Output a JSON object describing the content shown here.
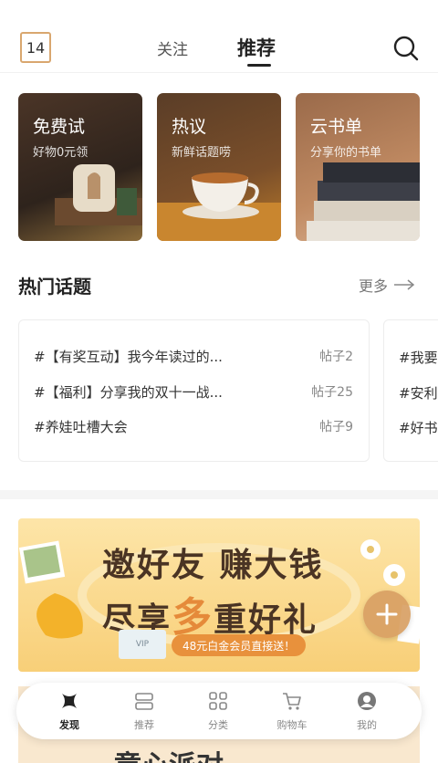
{
  "header": {
    "day_badge": "14",
    "tabs": [
      "关注",
      "推荐"
    ],
    "active_tab": "推荐",
    "search_icon": "search-icon"
  },
  "cards": [
    {
      "title": "免费试",
      "subtitle": "好物0元领"
    },
    {
      "title": "热议",
      "subtitle": "新鲜话题唠"
    },
    {
      "title": "云书单",
      "subtitle": "分享你的书单"
    }
  ],
  "hot_topics": {
    "title": "热门话题",
    "more": "更多",
    "items": [
      {
        "name": "#【有奖互动】我今年读过的...",
        "count": "帖子2"
      },
      {
        "name": "#【福利】分享我的双十一战...",
        "count": "帖子25"
      },
      {
        "name": "#养娃吐槽大会",
        "count": "帖子9"
      }
    ],
    "peek_items": [
      "#我要",
      "#安利",
      "#好书"
    ]
  },
  "banner": {
    "line1": "邀好友 赚大钱",
    "line2_prefix": "尽享",
    "line2_accent": "多",
    "line2_suffix": "重好礼",
    "pill": "48元白金会员直接送！",
    "vip_label": "VIP"
  },
  "next_banner_text": "童心派对",
  "bottom_nav": [
    {
      "label": "发现",
      "icon": "discover-icon",
      "active": true
    },
    {
      "label": "推荐",
      "icon": "recommend-icon",
      "active": false
    },
    {
      "label": "分类",
      "icon": "category-icon",
      "active": false
    },
    {
      "label": "购物车",
      "icon": "cart-icon",
      "active": false
    },
    {
      "label": "我的",
      "icon": "profile-icon",
      "active": false
    }
  ],
  "colors": {
    "accent": "#e58a3a",
    "badge_border": "#d9a76f",
    "banner_bg": "#f8cf78"
  }
}
